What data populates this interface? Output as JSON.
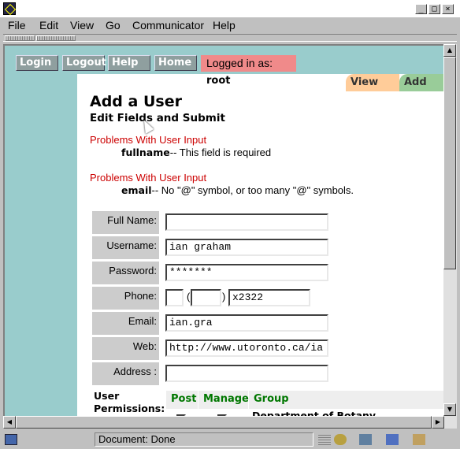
{
  "window": {
    "title": ""
  },
  "menu": {
    "items": [
      "File",
      "Edit",
      "View",
      "Go",
      "Communicator",
      "Help"
    ]
  },
  "nav": {
    "buttons": [
      "Login",
      "Logout",
      "Help",
      "Home"
    ],
    "logged_in_prefix": "Logged in as: ",
    "logged_in_user": "root"
  },
  "tabs": {
    "view": "View",
    "add": "Add"
  },
  "page": {
    "title": "Add a User",
    "subtitle": "Edit Fields and Submit"
  },
  "errors": [
    {
      "title": "Problems With User Input",
      "field": "fullname",
      "message": "-- This field is required"
    },
    {
      "title": "Problems With User Input",
      "field": "email",
      "message": "-- No \"@\" symbol, or too many \"@\" symbols."
    }
  ],
  "form": {
    "fields": [
      {
        "label": "Full Name:",
        "value": ""
      },
      {
        "label": "Username:",
        "value": "ian graham"
      },
      {
        "label": "Password:",
        "value": "*******"
      },
      {
        "label": "Phone:",
        "value": ""
      },
      {
        "label": "Email:",
        "value": "ian.gra"
      },
      {
        "label": "Web:",
        "value": "http://www.utoronto.ca/ia"
      },
      {
        "label": "Address :",
        "value": ""
      }
    ],
    "phone": {
      "country": "",
      "area": "",
      "number": "x2322",
      "open_paren": "(",
      "close_paren": ")"
    }
  },
  "permissions": {
    "label": "User Permissions:",
    "headers": [
      "Post",
      "Manage",
      "Group"
    ],
    "rows": [
      {
        "group": "Department of Botany"
      }
    ]
  },
  "status": {
    "text": "Document: Done"
  },
  "colors": {
    "nav_bg": "#99cccc",
    "logged_bg": "#f08a8a",
    "error_red": "#cc0000",
    "tab_view": "#ffcc99",
    "tab_add": "#99cc99",
    "perm_header_green": "#007700"
  }
}
